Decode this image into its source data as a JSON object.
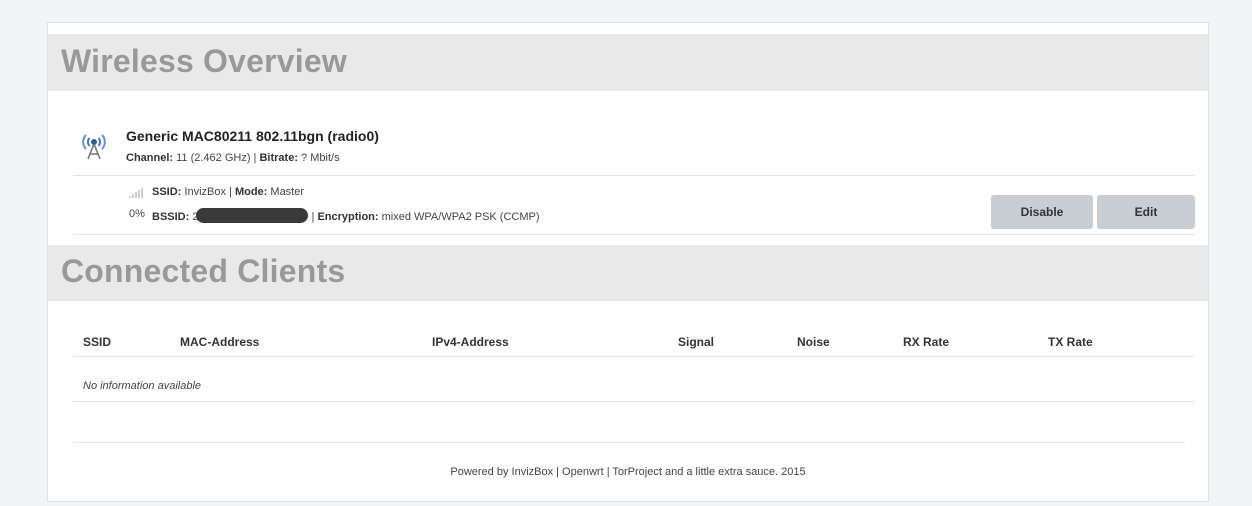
{
  "wireless_overview": {
    "title": "Wireless Overview",
    "radio": {
      "name": "Generic MAC80211 802.11bgn (radio0)",
      "channel_label": "Channel:",
      "channel_value": " 11 (2.462 GHz) | ",
      "bitrate_label": "Bitrate:",
      "bitrate_value": " ? Mbit/s",
      "icon": "wifi-radio-icon"
    },
    "network": {
      "signal_percent": "0%",
      "signal_icon": "signal-bars-icon",
      "ssid_label": "SSID:",
      "ssid_value": " InvizBox | ",
      "mode_label": "Mode:",
      "mode_value": " Master",
      "bssid_label": "BSSID:",
      "bssid_prefix": " 2",
      "encryption_sep": " | ",
      "encryption_label": "Encryption:",
      "encryption_value": " mixed WPA/WPA2 PSK (CCMP)"
    },
    "buttons": {
      "disable": "Disable",
      "edit": "Edit"
    }
  },
  "connected_clients": {
    "title": "Connected Clients",
    "columns": [
      "SSID",
      "MAC-Address",
      "IPv4-Address",
      "Signal",
      "Noise",
      "RX Rate",
      "TX Rate"
    ],
    "empty_message": "No information available"
  },
  "footer": {
    "text": "Powered by InvizBox | Openwrt | TorProject and a little extra sauce. 2015"
  },
  "colors": {
    "header_bg": "#e9e9e9",
    "header_text": "#999999",
    "button_bg": "#c9ced4"
  }
}
